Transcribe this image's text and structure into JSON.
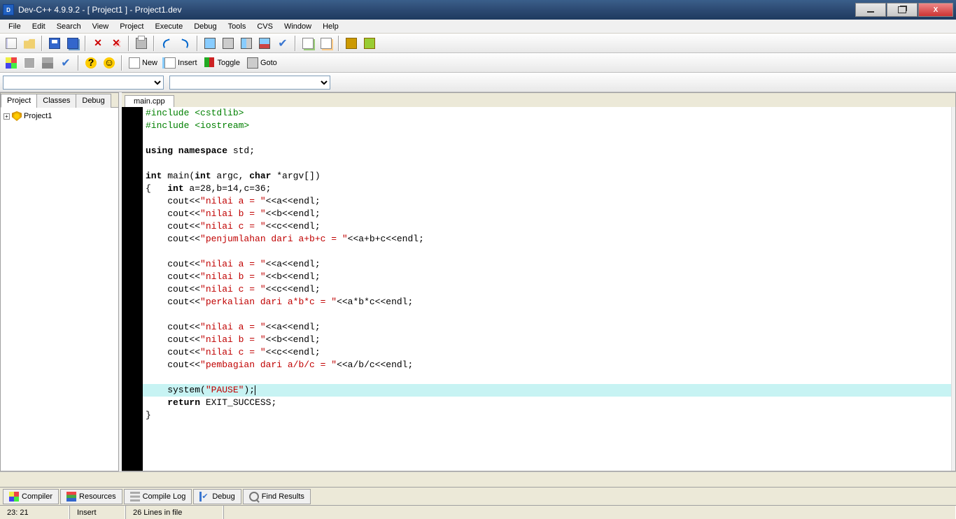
{
  "title": "Dev-C++ 4.9.9.2  -  [ Project1 ] - Project1.dev",
  "menu": [
    "File",
    "Edit",
    "Search",
    "View",
    "Project",
    "Execute",
    "Debug",
    "Tools",
    "CVS",
    "Window",
    "Help"
  ],
  "toolbar2": {
    "new": "New",
    "insert": "Insert",
    "toggle": "Toggle",
    "goto": "Goto"
  },
  "left_tabs": [
    "Project",
    "Classes",
    "Debug"
  ],
  "tree": {
    "root": "Project1"
  },
  "editor_tab": "main.cpp",
  "code_lines": [
    {
      "t": "#include <cstdlib>",
      "cls": "pp"
    },
    {
      "t": "#include <iostream>",
      "cls": "pp"
    },
    {
      "t": ""
    },
    {
      "t": "using namespace std;",
      "seg": [
        {
          "s": "using namespace",
          "c": "kw"
        },
        {
          "s": " std;"
        }
      ]
    },
    {
      "t": ""
    },
    {
      "t": "int main(int argc, char *argv[])",
      "seg": [
        {
          "s": "int",
          "c": "kw"
        },
        {
          "s": " main("
        },
        {
          "s": "int",
          "c": "kw"
        },
        {
          "s": " argc, "
        },
        {
          "s": "char",
          "c": "kw"
        },
        {
          "s": " *argv[])"
        }
      ]
    },
    {
      "t": "{   int a=28,b=14,c=36;",
      "seg": [
        {
          "s": "{   "
        },
        {
          "s": "int",
          "c": "kw"
        },
        {
          "s": " a=28,b=14,c=36;"
        }
      ]
    },
    {
      "t": "    cout<<\"nilai a = \"<<a<<endl;",
      "seg": [
        {
          "s": "    cout<<"
        },
        {
          "s": "\"nilai a = \"",
          "c": "str"
        },
        {
          "s": "<<a<<endl;"
        }
      ]
    },
    {
      "t": "    cout<<\"nilai b = \"<<b<<endl;",
      "seg": [
        {
          "s": "    cout<<"
        },
        {
          "s": "\"nilai b = \"",
          "c": "str"
        },
        {
          "s": "<<b<<endl;"
        }
      ]
    },
    {
      "t": "    cout<<\"nilai c = \"<<c<<endl;",
      "seg": [
        {
          "s": "    cout<<"
        },
        {
          "s": "\"nilai c = \"",
          "c": "str"
        },
        {
          "s": "<<c<<endl;"
        }
      ]
    },
    {
      "t": "    cout<<\"penjumlahan dari a+b+c = \"<<a+b+c<<endl;",
      "seg": [
        {
          "s": "    cout<<"
        },
        {
          "s": "\"penjumlahan dari a+b+c = \"",
          "c": "str"
        },
        {
          "s": "<<a+b+c<<endl;"
        }
      ]
    },
    {
      "t": "    "
    },
    {
      "t": "    cout<<\"nilai a = \"<<a<<endl;",
      "seg": [
        {
          "s": "    cout<<"
        },
        {
          "s": "\"nilai a = \"",
          "c": "str"
        },
        {
          "s": "<<a<<endl;"
        }
      ]
    },
    {
      "t": "    cout<<\"nilai b = \"<<b<<endl;",
      "seg": [
        {
          "s": "    cout<<"
        },
        {
          "s": "\"nilai b = \"",
          "c": "str"
        },
        {
          "s": "<<b<<endl;"
        }
      ]
    },
    {
      "t": "    cout<<\"nilai c = \"<<c<<endl;",
      "seg": [
        {
          "s": "    cout<<"
        },
        {
          "s": "\"nilai c = \"",
          "c": "str"
        },
        {
          "s": "<<c<<endl;"
        }
      ]
    },
    {
      "t": "    cout<<\"perkalian dari a*b*c = \"<<a*b*c<<endl;",
      "seg": [
        {
          "s": "    cout<<"
        },
        {
          "s": "\"perkalian dari a*b*c = \"",
          "c": "str"
        },
        {
          "s": "<<a*b*c<<endl;"
        }
      ]
    },
    {
      "t": "    "
    },
    {
      "t": "    cout<<\"nilai a = \"<<a<<endl;",
      "seg": [
        {
          "s": "    cout<<"
        },
        {
          "s": "\"nilai a = \"",
          "c": "str"
        },
        {
          "s": "<<a<<endl;"
        }
      ]
    },
    {
      "t": "    cout<<\"nilai b = \"<<b<<endl;",
      "seg": [
        {
          "s": "    cout<<"
        },
        {
          "s": "\"nilai b = \"",
          "c": "str"
        },
        {
          "s": "<<b<<endl;"
        }
      ]
    },
    {
      "t": "    cout<<\"nilai c = \"<<c<<endl;",
      "seg": [
        {
          "s": "    cout<<"
        },
        {
          "s": "\"nilai c = \"",
          "c": "str"
        },
        {
          "s": "<<c<<endl;"
        }
      ]
    },
    {
      "t": "    cout<<\"pembagian dari a/b/c = \"<<a/b/c<<endl;",
      "seg": [
        {
          "s": "    cout<<"
        },
        {
          "s": "\"pembagian dari a/b/c = \"",
          "c": "str"
        },
        {
          "s": "<<a/b/c<<endl;"
        }
      ]
    },
    {
      "t": "    "
    },
    {
      "t": "    system(\"PAUSE\");",
      "seg": [
        {
          "s": "    system("
        },
        {
          "s": "\"PAUSE\"",
          "c": "str"
        },
        {
          "s": ");"
        }
      ],
      "hl": true,
      "caret": true
    },
    {
      "t": "    return EXIT_SUCCESS;",
      "seg": [
        {
          "s": "    "
        },
        {
          "s": "return",
          "c": "kw"
        },
        {
          "s": " EXIT_SUCCESS;"
        }
      ]
    },
    {
      "t": "}"
    }
  ],
  "bottom_tabs": [
    "Compiler",
    "Resources",
    "Compile Log",
    "Debug",
    "Find Results"
  ],
  "status": {
    "pos": "23: 21",
    "mode": "Insert",
    "lines": "26 Lines in file"
  }
}
